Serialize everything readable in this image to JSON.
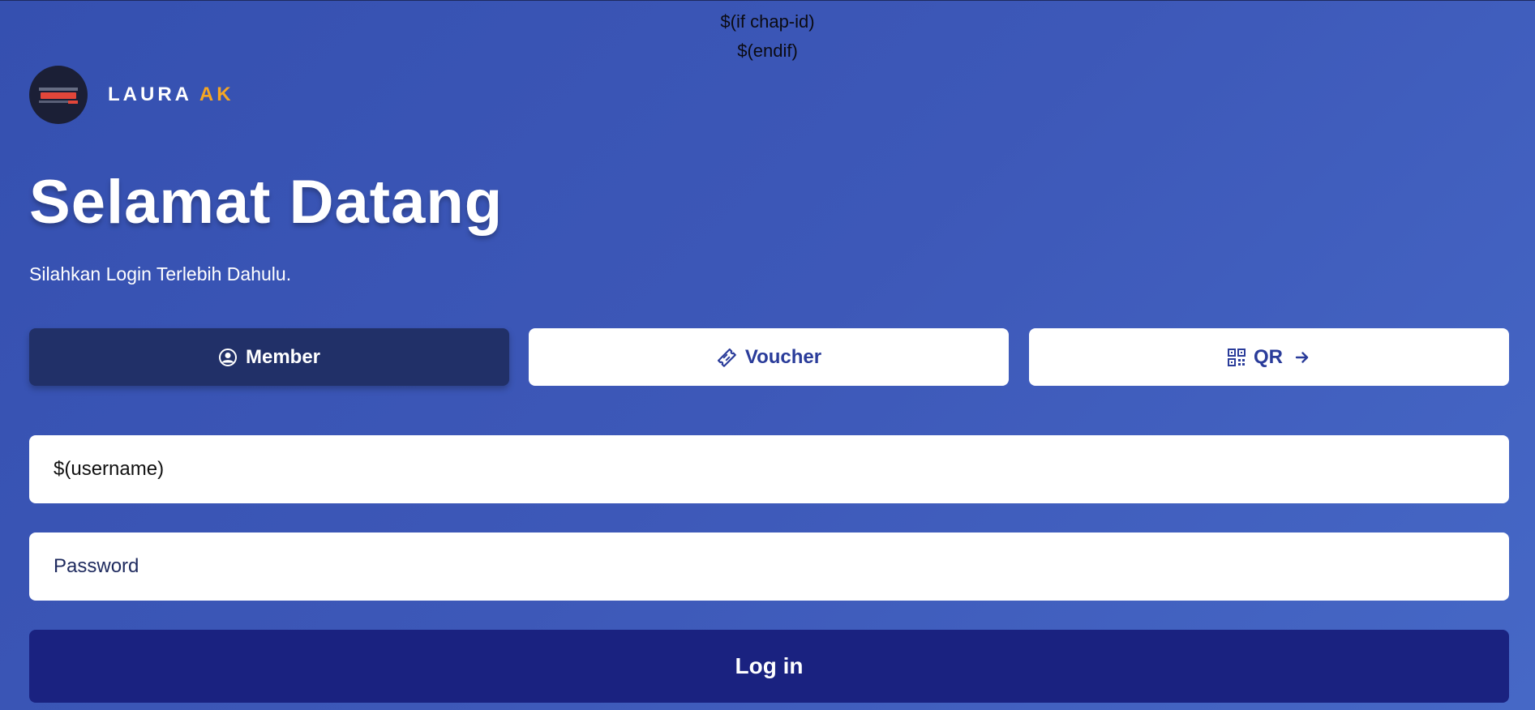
{
  "template": {
    "chap_if": "$(if chap-id)",
    "chap_endif": "$(endif)"
  },
  "brand": {
    "name_main": "LAURA",
    "name_accent": "AK",
    "accent_color": "#f5a623"
  },
  "hero": {
    "title": "Selamat Datang",
    "subtitle": "Silahkan Login Terlebih Dahulu."
  },
  "tabs": [
    {
      "label": "Member",
      "icon": "user-circle-icon",
      "active": true
    },
    {
      "label": "Voucher",
      "icon": "ticket-icon",
      "active": false
    },
    {
      "label": "QR",
      "icon": "qr-code-icon",
      "trailing_icon": "arrow-right-icon",
      "active": false
    }
  ],
  "form": {
    "username_value": "$(username)",
    "password_placeholder": "Password",
    "submit_label": "Log in"
  },
  "colors": {
    "background": "#3d58b8",
    "active_tab": "#213068",
    "login_button": "#1a2280",
    "tab_text": "#2a3c9a"
  }
}
